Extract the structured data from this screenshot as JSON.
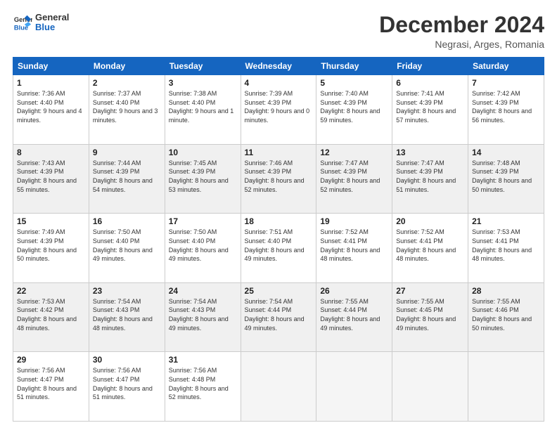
{
  "logo": {
    "line1": "General",
    "line2": "Blue"
  },
  "title": "December 2024",
  "subtitle": "Negrasi, Arges, Romania",
  "days": [
    "Sunday",
    "Monday",
    "Tuesday",
    "Wednesday",
    "Thursday",
    "Friday",
    "Saturday"
  ],
  "weeks": [
    [
      {
        "day": "1",
        "sunrise": "7:36 AM",
        "sunset": "4:40 PM",
        "daylight": "9 hours and 4 minutes."
      },
      {
        "day": "2",
        "sunrise": "7:37 AM",
        "sunset": "4:40 PM",
        "daylight": "9 hours and 3 minutes."
      },
      {
        "day": "3",
        "sunrise": "7:38 AM",
        "sunset": "4:40 PM",
        "daylight": "9 hours and 1 minute."
      },
      {
        "day": "4",
        "sunrise": "7:39 AM",
        "sunset": "4:39 PM",
        "daylight": "9 hours and 0 minutes."
      },
      {
        "day": "5",
        "sunrise": "7:40 AM",
        "sunset": "4:39 PM",
        "daylight": "8 hours and 59 minutes."
      },
      {
        "day": "6",
        "sunrise": "7:41 AM",
        "sunset": "4:39 PM",
        "daylight": "8 hours and 57 minutes."
      },
      {
        "day": "7",
        "sunrise": "7:42 AM",
        "sunset": "4:39 PM",
        "daylight": "8 hours and 56 minutes."
      }
    ],
    [
      {
        "day": "8",
        "sunrise": "7:43 AM",
        "sunset": "4:39 PM",
        "daylight": "8 hours and 55 minutes."
      },
      {
        "day": "9",
        "sunrise": "7:44 AM",
        "sunset": "4:39 PM",
        "daylight": "8 hours and 54 minutes."
      },
      {
        "day": "10",
        "sunrise": "7:45 AM",
        "sunset": "4:39 PM",
        "daylight": "8 hours and 53 minutes."
      },
      {
        "day": "11",
        "sunrise": "7:46 AM",
        "sunset": "4:39 PM",
        "daylight": "8 hours and 52 minutes."
      },
      {
        "day": "12",
        "sunrise": "7:47 AM",
        "sunset": "4:39 PM",
        "daylight": "8 hours and 52 minutes."
      },
      {
        "day": "13",
        "sunrise": "7:47 AM",
        "sunset": "4:39 PM",
        "daylight": "8 hours and 51 minutes."
      },
      {
        "day": "14",
        "sunrise": "7:48 AM",
        "sunset": "4:39 PM",
        "daylight": "8 hours and 50 minutes."
      }
    ],
    [
      {
        "day": "15",
        "sunrise": "7:49 AM",
        "sunset": "4:39 PM",
        "daylight": "8 hours and 50 minutes."
      },
      {
        "day": "16",
        "sunrise": "7:50 AM",
        "sunset": "4:40 PM",
        "daylight": "8 hours and 49 minutes."
      },
      {
        "day": "17",
        "sunrise": "7:50 AM",
        "sunset": "4:40 PM",
        "daylight": "8 hours and 49 minutes."
      },
      {
        "day": "18",
        "sunrise": "7:51 AM",
        "sunset": "4:40 PM",
        "daylight": "8 hours and 49 minutes."
      },
      {
        "day": "19",
        "sunrise": "7:52 AM",
        "sunset": "4:41 PM",
        "daylight": "8 hours and 48 minutes."
      },
      {
        "day": "20",
        "sunrise": "7:52 AM",
        "sunset": "4:41 PM",
        "daylight": "8 hours and 48 minutes."
      },
      {
        "day": "21",
        "sunrise": "7:53 AM",
        "sunset": "4:41 PM",
        "daylight": "8 hours and 48 minutes."
      }
    ],
    [
      {
        "day": "22",
        "sunrise": "7:53 AM",
        "sunset": "4:42 PM",
        "daylight": "8 hours and 48 minutes."
      },
      {
        "day": "23",
        "sunrise": "7:54 AM",
        "sunset": "4:43 PM",
        "daylight": "8 hours and 48 minutes."
      },
      {
        "day": "24",
        "sunrise": "7:54 AM",
        "sunset": "4:43 PM",
        "daylight": "8 hours and 49 minutes."
      },
      {
        "day": "25",
        "sunrise": "7:54 AM",
        "sunset": "4:44 PM",
        "daylight": "8 hours and 49 minutes."
      },
      {
        "day": "26",
        "sunrise": "7:55 AM",
        "sunset": "4:44 PM",
        "daylight": "8 hours and 49 minutes."
      },
      {
        "day": "27",
        "sunrise": "7:55 AM",
        "sunset": "4:45 PM",
        "daylight": "8 hours and 49 minutes."
      },
      {
        "day": "28",
        "sunrise": "7:55 AM",
        "sunset": "4:46 PM",
        "daylight": "8 hours and 50 minutes."
      }
    ],
    [
      {
        "day": "29",
        "sunrise": "7:56 AM",
        "sunset": "4:47 PM",
        "daylight": "8 hours and 51 minutes."
      },
      {
        "day": "30",
        "sunrise": "7:56 AM",
        "sunset": "4:47 PM",
        "daylight": "8 hours and 51 minutes."
      },
      {
        "day": "31",
        "sunrise": "7:56 AM",
        "sunset": "4:48 PM",
        "daylight": "8 hours and 52 minutes."
      },
      null,
      null,
      null,
      null
    ]
  ]
}
